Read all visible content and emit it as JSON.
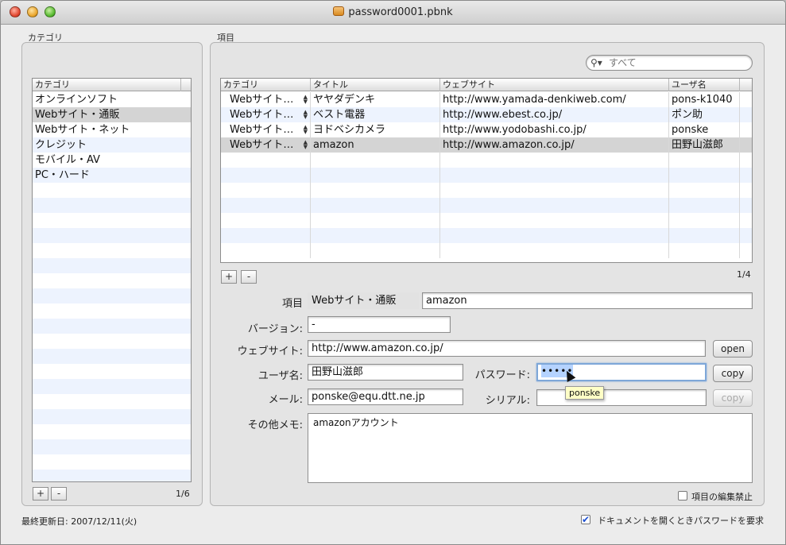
{
  "window": {
    "title": "password0001.pbnk"
  },
  "categories_panel": {
    "group_label": "カテゴリ",
    "column_header": "カテゴリ",
    "items": [
      "オンラインソフト",
      "Webサイト・通販",
      "Webサイト・ネット",
      "クレジット",
      "モバイル・AV",
      "PC・ハード"
    ],
    "selected_index": 1,
    "add_label": "+",
    "remove_label": "-",
    "count": "1/6"
  },
  "items_panel": {
    "group_label": "項目",
    "search": {
      "placeholder": "すべて",
      "icon": "search-icon"
    },
    "columns": [
      "カテゴリ",
      "タイトル",
      "ウェブサイト",
      "ユーザ名"
    ],
    "rows": [
      {
        "category": "Webサイト…",
        "title": "ヤヤダデンキ",
        "website": "http://www.yamada-denkiweb.com/",
        "user": "pons-k1040"
      },
      {
        "category": "Webサイト…",
        "title": "ベスト電器",
        "website": "http://www.ebest.co.jp/",
        "user": "ポン助"
      },
      {
        "category": "Webサイト…",
        "title": "ヨドベシカメラ",
        "website": "http://www.yodobashi.co.jp/",
        "user": "ponske"
      },
      {
        "category": "Webサイト…",
        "title": "amazon",
        "website": "http://www.amazon.co.jp/",
        "user": "田野山滋郎"
      }
    ],
    "selected_index": 3,
    "add_label": "+",
    "remove_label": "-",
    "count": "1/4"
  },
  "detail": {
    "item_label": "項目",
    "item_category": "Webサイト・通販",
    "item_title": "amazon",
    "version_label": "バージョン:",
    "version_value": "-",
    "website_label": "ウェブサイト:",
    "website_value": "http://www.amazon.co.jp/",
    "open_label": "open",
    "user_label": "ユーザ名:",
    "user_value": "田野山滋郎",
    "password_label": "パスワード:",
    "password_masked": "•••••",
    "copy_label": "copy",
    "mail_label": "メール:",
    "mail_value": "ponske@equ.dtt.ne.jp",
    "serial_label": "シリアル:",
    "serial_value": "",
    "copy_serial_label": "copy",
    "memo_label": "その他メモ:",
    "memo_value": "amazonアカウント",
    "tooltip": "ponske",
    "lock_label": "項目の編集禁止",
    "lock_checked": false
  },
  "footer": {
    "last_updated": "最終更新日: 2007/12/11(火)",
    "require_password_label": "ドキュメントを開くときパスワードを要求",
    "require_password_checked": true
  }
}
